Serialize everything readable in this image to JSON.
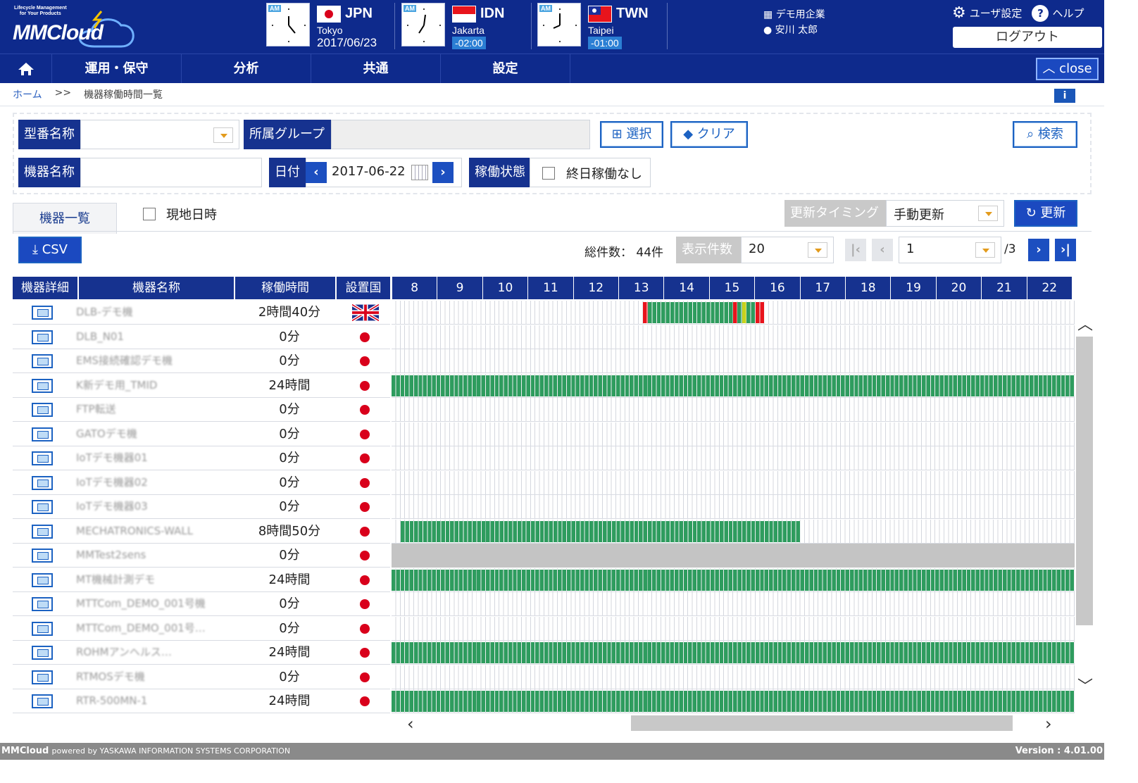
{
  "header": {
    "logo_tagline_line1": "Lifecycle Management",
    "logo_tagline_line2": "for Your Products",
    "logo_name": "MMCloud",
    "clocks": [
      {
        "am_label": "AM",
        "country_code": "JPN",
        "city": "Tokyo",
        "date": "2017/06/23",
        "offset": ""
      },
      {
        "am_label": "AM",
        "country_code": "IDN",
        "city": "Jakarta",
        "date": "",
        "offset": "-02:00"
      },
      {
        "am_label": "AM",
        "country_code": "TWN",
        "city": "Taipei",
        "date": "",
        "offset": "-01:00"
      }
    ],
    "company_name": "デモ用企業",
    "user_name": "安川 太郎",
    "user_settings_label": "ユーザ設定",
    "help_label": "ヘルプ",
    "logout_label": "ログアウト"
  },
  "nav": {
    "items": [
      {
        "label": "運用・保守"
      },
      {
        "label": "分析"
      },
      {
        "label": "共通"
      },
      {
        "label": "設定"
      }
    ],
    "close_label": "close"
  },
  "breadcrumb": {
    "home": "ホーム",
    "separator": ">>",
    "current": "機器稼働時間一覧"
  },
  "search": {
    "model_label": "型番名称",
    "model_value": "",
    "group_label": "所属グループ",
    "group_value": "",
    "select_label": "選択",
    "clear_label": "クリア",
    "search_label": "検索",
    "device_label": "機器名称",
    "device_value": "",
    "date_label": "日付",
    "date_value": "2017-06-22",
    "status_label": "稼働状態",
    "status_checkbox_label": "終日稼働なし"
  },
  "list": {
    "tab_label": "機器一覧",
    "local_time_label": "現地日時",
    "update_timing_label": "更新タイミング",
    "update_timing_value": "手動更新",
    "refresh_label": "更新",
    "csv_label": "CSV",
    "total_label": "総件数：",
    "total_value": "44件",
    "page_size_label": "表示件数",
    "page_size_value": "20",
    "page_value": "1",
    "page_total": "/3"
  },
  "table": {
    "columns": [
      "機器詳細",
      "機器名称",
      "稼働時間",
      "設置国"
    ],
    "hours": [
      "8",
      "9",
      "10",
      "11",
      "12",
      "13",
      "14",
      "15",
      "16",
      "17",
      "18",
      "19",
      "20",
      "21",
      "22"
    ],
    "colors": {
      "running": "#2e9c5e",
      "stopped": "#e8141c",
      "warning": "#c8d21c",
      "offline": "#c4c4c4"
    },
    "rows": [
      {
        "name": "DLB-デモ機",
        "time": "2時間40分",
        "country": "GBR",
        "timeline": "mixed"
      },
      {
        "name": "DLB_N01",
        "time": "0分",
        "country": "JPN",
        "timeline": "none"
      },
      {
        "name": "EMS接続確認デモ機",
        "time": "0分",
        "country": "JPN",
        "timeline": "none"
      },
      {
        "name": "K新デモ用_TMID",
        "time": "24時間",
        "country": "JPN",
        "timeline": "full"
      },
      {
        "name": "FTP転送",
        "time": "0分",
        "country": "JPN",
        "timeline": "none"
      },
      {
        "name": "GATOデモ機",
        "time": "0分",
        "country": "JPN",
        "timeline": "none"
      },
      {
        "name": "IoTデモ機器01",
        "time": "0分",
        "country": "JPN",
        "timeline": "none"
      },
      {
        "name": "IoTデモ機器02",
        "time": "0分",
        "country": "JPN",
        "timeline": "none"
      },
      {
        "name": "IoTデモ機器03",
        "time": "0分",
        "country": "JPN",
        "timeline": "none"
      },
      {
        "name": "MECHATRONICS-WALL",
        "time": "8時間50分",
        "country": "JPN",
        "timeline": "partial"
      },
      {
        "name": "MMTest2sens",
        "time": "0分",
        "country": "JPN",
        "timeline": "offline"
      },
      {
        "name": "MT機械計測デモ",
        "time": "24時間",
        "country": "JPN",
        "timeline": "full"
      },
      {
        "name": "MTTCom_DEMO_001号機",
        "time": "0分",
        "country": "JPN",
        "timeline": "none"
      },
      {
        "name": "MTTCom_DEMO_001号…",
        "time": "0分",
        "country": "JPN",
        "timeline": "none"
      },
      {
        "name": "ROHMアンヘルス…",
        "time": "24時間",
        "country": "JPN",
        "timeline": "full"
      },
      {
        "name": "RTMOSデモ機",
        "time": "0分",
        "country": "JPN",
        "timeline": "none"
      },
      {
        "name": "RTR-500MN-1",
        "time": "24時間",
        "country": "JPN",
        "timeline": "full"
      }
    ]
  },
  "footer": {
    "brand": "MMCloud",
    "powered": "powered by YASKAWA INFORMATION SYSTEMS CORPORATION",
    "version": "Version : 4.01.00"
  }
}
